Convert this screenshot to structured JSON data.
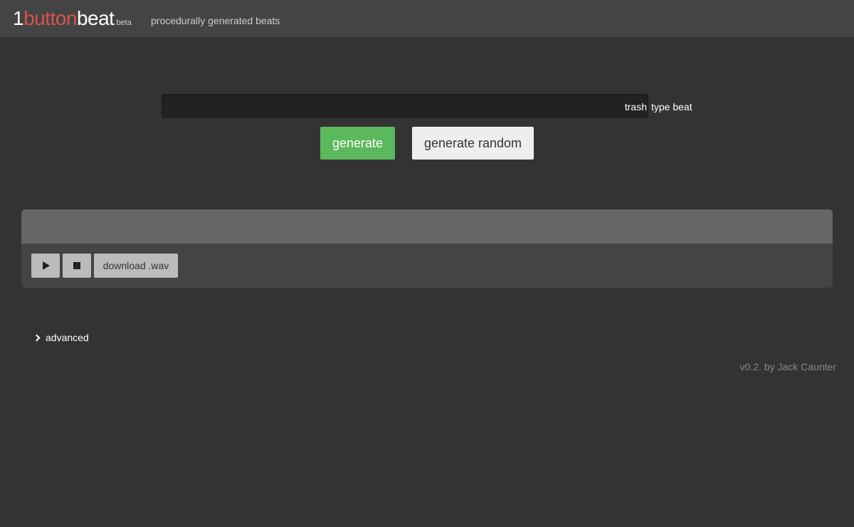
{
  "header": {
    "logo": {
      "one": "1",
      "button": "button",
      "beat": "beat",
      "beta": "beta"
    },
    "tagline": "procedurally generated beats"
  },
  "search": {
    "value": "",
    "placeholder": "",
    "overlay_text": "trash",
    "suffix": "type beat"
  },
  "actions": {
    "generate_label": "generate",
    "generate_random_label": "generate random"
  },
  "player": {
    "play_icon": "play-icon",
    "stop_icon": "stop-icon",
    "download_label": "download .wav"
  },
  "advanced": {
    "icon": "chevron-right-icon",
    "label": "advanced"
  },
  "footer": {
    "credit": "v0.2. by Jack Caunter"
  },
  "colors": {
    "background": "#333333",
    "topbar": "#444444",
    "brand_red": "#d9534f",
    "generate_green": "#5cb85c"
  }
}
